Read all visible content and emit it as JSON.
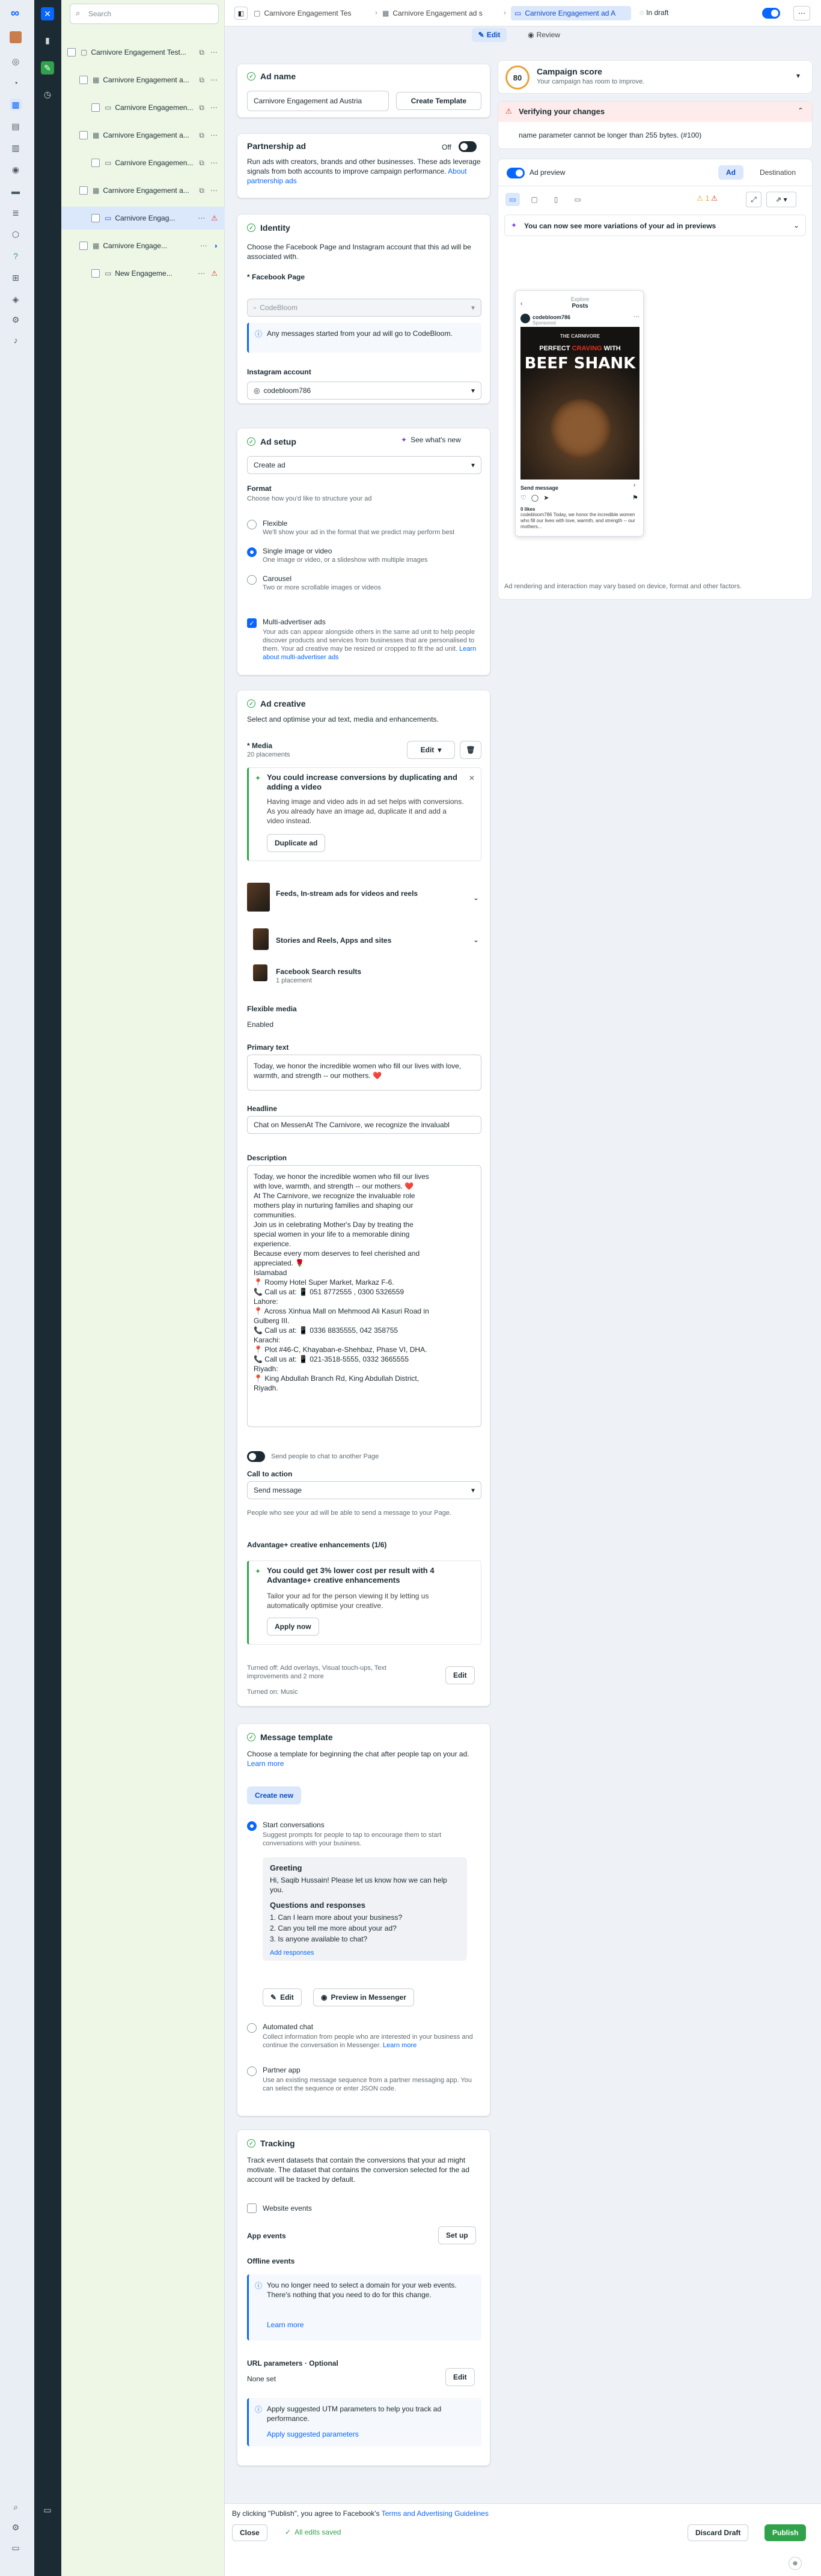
{
  "search": {
    "placeholder": "Search"
  },
  "tree": {
    "items": [
      {
        "label": "Carnivore Engagement Test..."
      },
      {
        "label": "Carnivore Engagement a..."
      },
      {
        "label": "Carnivore Engagemen..."
      },
      {
        "label": "Carnivore Engagement a..."
      },
      {
        "label": "Carnivore Engagemen..."
      },
      {
        "label": "Carnivore Engagement a..."
      },
      {
        "label": "Carnivore Engag..."
      },
      {
        "label": "Carnivore Engage..."
      },
      {
        "label": "New Engageme..."
      }
    ]
  },
  "breadcrumb": {
    "campaign": "Carnivore Engagement Tes",
    "adset": "Carnivore Engagement ad s",
    "ad": "Carnivore Engagement ad A",
    "status": "In draft"
  },
  "mode": {
    "edit": "Edit",
    "review": "Review"
  },
  "ad_name": {
    "title": "Ad name",
    "value": "Carnivore Engagement ad  Austria",
    "template_button": "Create Template"
  },
  "partnership": {
    "title": "Partnership ad",
    "toggle_label": "Off",
    "desc": "Run ads with creators, brands and other businesses. These ads leverage signals from both accounts to improve campaign performance.",
    "link": "About partnership ads"
  },
  "identity": {
    "title": "Identity",
    "desc": "Choose the Facebook Page and Instagram account that this ad will be associated with.",
    "fb_label": "* Facebook Page",
    "fb_value": "CodeBloom",
    "fb_notice": "Any messages started from your ad will go to CodeBloom.",
    "ig_label": "Instagram account",
    "ig_value": "codebloom786"
  },
  "ad_setup": {
    "title": "Ad setup",
    "whats_new": "See what's new",
    "create_select": "Create ad",
    "format_label": "Format",
    "format_desc": "Choose how you'd like to structure your ad",
    "options": [
      {
        "title": "Flexible",
        "desc": "We'll show your ad in the format that we predict may perform best"
      },
      {
        "title": "Single image or video",
        "desc": "One image or video, or a slideshow with multiple images"
      },
      {
        "title": "Carousel",
        "desc": "Two or more scrollable images or videos"
      }
    ],
    "multi_title": "Multi-advertiser ads",
    "multi_desc": "Your ads can appear alongside others in the same ad unit to help people discover products and services from businesses that are personalised to them. Your ad creative may be resized or cropped to fit the ad unit.",
    "multi_link": "Learn about multi-advertiser ads"
  },
  "ad_creative": {
    "title": "Ad creative",
    "desc": "Select and optimise your ad text, media and enhancements.",
    "media_label": "* Media",
    "media_sub": "20 placements",
    "edit_button": "Edit",
    "tip_title": "You could increase conversions by duplicating and adding a video",
    "tip_desc": "Having image and video ads in ad set helps with conversions. As you already have an image ad, duplicate it and add a video instead.",
    "tip_button": "Duplicate ad",
    "placements": [
      {
        "title": "Feeds, In-stream ads for videos and reels",
        "sub": ""
      },
      {
        "title": "Stories and Reels, Apps and sites",
        "sub": ""
      },
      {
        "title": "Facebook Search results",
        "sub": "1 placement"
      }
    ],
    "flex_label": "Flexible media",
    "flex_value": "Enabled",
    "primary_label": "Primary text",
    "primary_value": "Today, we honor the incredible women who fill our lives with love, warmth, and strength -- our mothers. ❤️",
    "headline_label": "Headline",
    "headline_value": "Chat on MessenAt The Carnivore, we recognize the invaluabl",
    "desc_label": "Description",
    "desc_lines": [
      "Today, we honor the incredible women who fill our lives",
      "with love, warmth, and strength -- our mothers. ❤️",
      "At The Carnivore, we recognize the invaluable role",
      "mothers play in nurturing families and shaping our",
      "communities.",
      "Join us in celebrating Mother's Day by treating the",
      "special women in your life to a memorable dining",
      "experience.",
      "Because every mom deserves to feel cherished and",
      "appreciated. 🌹",
      "Islamabad",
      "📍 Roomy Hotel Super Market, Markaz F-6.",
      "📞 Call us at: 📱 051 8772555 , 0300 5326559",
      "Lahore:",
      "📍 Across Xinhua Mall on Mehmood Ali Kasuri Road in",
      "Gulberg III.",
      "📞 Call us at: 📱 0336 8835555, 042 358755",
      "Karachi:",
      "📍 Plot #46-C, Khayaban-e-Shehbaz, Phase VI, DHA.",
      "📞 Call us at: 📱 021-3518-5555, 0332 3665555",
      "Riyadh:",
      "📍 King Abdullah Branch Rd, King Abdullah District,",
      "Riyadh."
    ],
    "send_people": "Send people to chat to another Page",
    "cta_label": "Call to action",
    "cta_value": "Send message",
    "cta_note": "People who see your ad will be able to send a message to your Page.",
    "adv_label": "Advantage+ creative enhancements (1/6)",
    "adv_title": "You could get 3% lower cost per result with 4 Advantage+ creative enhancements",
    "adv_desc": "Tailor your ad for the person viewing it by letting us automatically optimise your creative.",
    "apply_button": "Apply now",
    "turned_off": "Turned off: Add overlays, Visual touch-ups, Text improvements and 2 more",
    "turned_on": "Turned on: Music",
    "adv_edit": "Edit"
  },
  "message_template": {
    "title": "Message template",
    "desc": "Choose a template for beginning the chat after people tap on your ad.",
    "link": "Learn more",
    "create_button": "Create new",
    "opt1_title": "Start conversations",
    "opt1_desc": "Suggest prompts for people to tap to encourage them to start conversations with your business.",
    "greeting_label": "Greeting",
    "greeting": "Hi, Saqib Hussain! Please let us know how we can help you.",
    "qa_label": "Questions and responses",
    "questions": [
      "1. Can I learn more about your business?",
      "2. Can you tell me more about your ad?",
      "3. Is anyone available to chat?"
    ],
    "add_responses": "Add responses",
    "edit_button": "Edit",
    "preview_button": "Preview in Messenger",
    "opt2_title": "Automated chat",
    "opt2_desc": "Collect information from people who are interested in your business and continue the conversation in Messenger.",
    "opt3_title": "Partner app",
    "opt3_desc": "Use an existing message sequence from a partner messaging app. You can select the sequence or enter JSON code."
  },
  "tracking": {
    "title": "Tracking",
    "desc": "Track event datasets that contain the conversions that your ad might motivate. The dataset that contains the conversion selected for the ad account will be tracked by default.",
    "website": "Website events",
    "app": "App events",
    "setup_button": "Set up",
    "offline": "Offline events",
    "notice": "You no longer need to select a domain for your web events. There's nothing that you need to do for this change.",
    "learn": "Learn more",
    "url_label": "URL parameters · Optional",
    "url_value": "None set",
    "url_edit": "Edit",
    "utm_text": "Apply suggested UTM parameters to help you track ad performance.",
    "utm_link": "Apply suggested parameters"
  },
  "right": {
    "score_value": "80",
    "score_title": "Campaign score",
    "score_sub": "Your campaign has room to improve.",
    "verify_title": "Verifying your changes",
    "verify_error": "name parameter cannot be longer than 255 bytes. (#100)",
    "preview_label": "Ad preview",
    "tab_ad": "Ad",
    "tab_dest": "Destination",
    "warn_count": "1",
    "variations": "You can now see more variations of your ad in previews",
    "phone_header": "Explore",
    "phone_sub": "Posts",
    "account": "codebloom786",
    "sponsored": "Sponsored",
    "poster_top": "THE CARNIVORE",
    "poster_small": "PERFECT",
    "poster_red": "CRAVING",
    "poster_with": "WITH",
    "poster_big": "BEEF SHANK",
    "send_message": "Send message",
    "likes": "0 likes",
    "caption": "codebloom786 Today, we honor the incredible women who fill our lives with love, warmth, and strength -- our mothers...",
    "disclaimer": "Ad rendering and interaction may vary based on device, format and other factors."
  },
  "footer": {
    "agree": "By clicking \"Publish\", you agree to Facebook's",
    "terms": "Terms and Advertising Guidelines",
    "close": "Close",
    "saved": "All edits saved",
    "discard": "Discard Draft",
    "publish": "Publish"
  },
  "colors": {
    "accent": "#0866ff",
    "success": "#31a24c",
    "warning": "#e8a33d",
    "error": "#e0301e"
  }
}
